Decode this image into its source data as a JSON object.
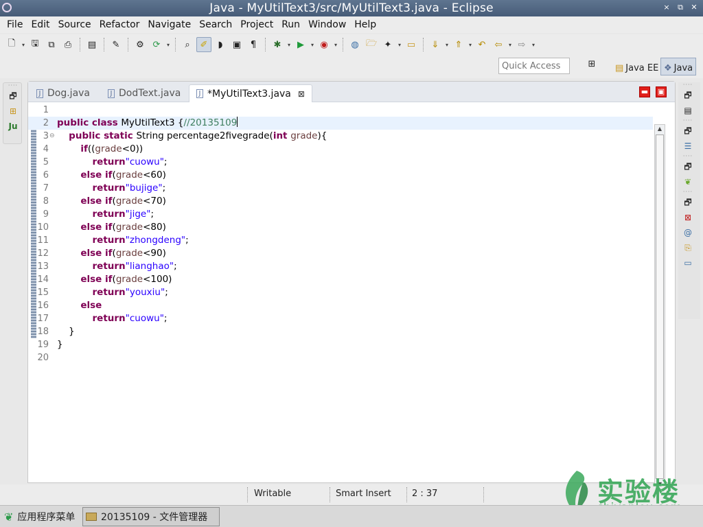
{
  "window": {
    "title": "Java - MyUtilText3/src/MyUtilText3.java - Eclipse",
    "controls": [
      "×",
      "⧉",
      "✕"
    ]
  },
  "menu": [
    "File",
    "Edit",
    "Source",
    "Refactor",
    "Navigate",
    "Search",
    "Project",
    "Run",
    "Window",
    "Help"
  ],
  "quick_access": {
    "placeholder": "Quick Access"
  },
  "perspectives": {
    "open_label": "⊞",
    "java_ee": "Java EE",
    "java": "Java"
  },
  "tabs": [
    {
      "label": "Dog.java",
      "active": false
    },
    {
      "label": "DodText.java",
      "active": false
    },
    {
      "label": "*MyUtilText3.java",
      "active": true
    }
  ],
  "tab_close": "⊠",
  "editor_controls": {
    "minimize": "▬",
    "maximize": "▣"
  },
  "code": {
    "line_numbers": [
      "1",
      "2",
      "3",
      "4",
      "5",
      "6",
      "7",
      "8",
      "9",
      "10",
      "11",
      "12",
      "13",
      "14",
      "15",
      "16",
      "17",
      "18",
      "19",
      "20"
    ],
    "lines": [
      [],
      [
        [
          "kw",
          "public class "
        ],
        [
          "",
          "MyUtilText3 {"
        ],
        [
          "cm",
          "//20135109"
        ]
      ],
      [
        [
          "",
          "    "
        ],
        [
          "kw",
          "public static "
        ],
        [
          "",
          "String percentage2fivegrade("
        ],
        [
          "kw",
          "int "
        ],
        [
          "var",
          "grade"
        ],
        [
          "",
          "){"
        ]
      ],
      [
        [
          "",
          "        "
        ],
        [
          "kw",
          "if"
        ],
        [
          "",
          "(("
        ],
        [
          "var",
          "grade"
        ],
        [
          "",
          "<0))"
        ]
      ],
      [
        [
          "",
          "            "
        ],
        [
          "kw",
          "return"
        ],
        [
          "str",
          "\"cuowu\""
        ],
        [
          "",
          ";"
        ]
      ],
      [
        [
          "",
          "        "
        ],
        [
          "kw",
          "else if"
        ],
        [
          "",
          "("
        ],
        [
          "var",
          "grade"
        ],
        [
          "",
          "<60)"
        ]
      ],
      [
        [
          "",
          "            "
        ],
        [
          "kw",
          "return"
        ],
        [
          "str",
          "\"bujige\""
        ],
        [
          "",
          ";"
        ]
      ],
      [
        [
          "",
          "        "
        ],
        [
          "kw",
          "else if"
        ],
        [
          "",
          "("
        ],
        [
          "var",
          "grade"
        ],
        [
          "",
          "<70)"
        ]
      ],
      [
        [
          "",
          "            "
        ],
        [
          "kw",
          "return"
        ],
        [
          "str",
          "\"jige\""
        ],
        [
          "",
          ";"
        ]
      ],
      [
        [
          "",
          "        "
        ],
        [
          "kw",
          "else if"
        ],
        [
          "",
          "("
        ],
        [
          "var",
          "grade"
        ],
        [
          "",
          "<80)"
        ]
      ],
      [
        [
          "",
          "            "
        ],
        [
          "kw",
          "return"
        ],
        [
          "str",
          "\"zhongdeng\""
        ],
        [
          "",
          ";"
        ]
      ],
      [
        [
          "",
          "        "
        ],
        [
          "kw",
          "else if"
        ],
        [
          "",
          "("
        ],
        [
          "var",
          "grade"
        ],
        [
          "",
          "<90)"
        ]
      ],
      [
        [
          "",
          "            "
        ],
        [
          "kw",
          "return"
        ],
        [
          "str",
          "\"lianghao\""
        ],
        [
          "",
          ";"
        ]
      ],
      [
        [
          "",
          "        "
        ],
        [
          "kw",
          "else if"
        ],
        [
          "",
          "("
        ],
        [
          "var",
          "grade"
        ],
        [
          "",
          "<100)"
        ]
      ],
      [
        [
          "",
          "            "
        ],
        [
          "kw",
          "return"
        ],
        [
          "str",
          "\"youxiu\""
        ],
        [
          "",
          ";"
        ]
      ],
      [
        [
          "",
          "        "
        ],
        [
          "kw",
          "else"
        ]
      ],
      [
        [
          "",
          "            "
        ],
        [
          "kw",
          "return"
        ],
        [
          "str",
          "\"cuowu\""
        ],
        [
          "",
          ";"
        ]
      ],
      [
        [
          "",
          "    }"
        ]
      ],
      [
        [
          "",
          "}"
        ]
      ],
      []
    ],
    "current_line": 2,
    "fold_line": 3,
    "fold_glyph": "⊖"
  },
  "status": {
    "writable": "Writable",
    "insert_mode": "Smart Insert",
    "position": "2 : 37"
  },
  "watermark": {
    "brand": "实验楼",
    "url": "shiyanlou.com"
  },
  "taskbar": {
    "start_label": "应用程序菜单",
    "task_label": "20135109 - 文件管理器"
  },
  "icons": {
    "toolbar": [
      "new-icon",
      "save-icon",
      "save-all-icon",
      "print-icon",
      "binary-icon",
      "pin-icon",
      "build-icon",
      "refresh-icon",
      "search-next-icon",
      "highlight-icon",
      "mark-icon",
      "block-icon",
      "whitespace-icon",
      "debug-icon",
      "run-icon",
      "run-ext-icon",
      "open-type-icon",
      "open-folder-icon",
      "wand-icon",
      "open-task-icon",
      "next-annotation-icon",
      "prev-annotation-icon",
      "last-edit-icon",
      "back-icon",
      "forward-icon"
    ],
    "left_trim": [
      "restore-icon",
      "hierarchy-icon",
      "junit-icon"
    ],
    "right_trim": [
      "restore-icon",
      "outline-icon",
      "restore-icon",
      "task-list-icon",
      "restore-icon",
      "leaf-icon",
      "restore-icon",
      "problems-icon",
      "javadoc-icon",
      "declaration-icon",
      "console-icon"
    ]
  }
}
